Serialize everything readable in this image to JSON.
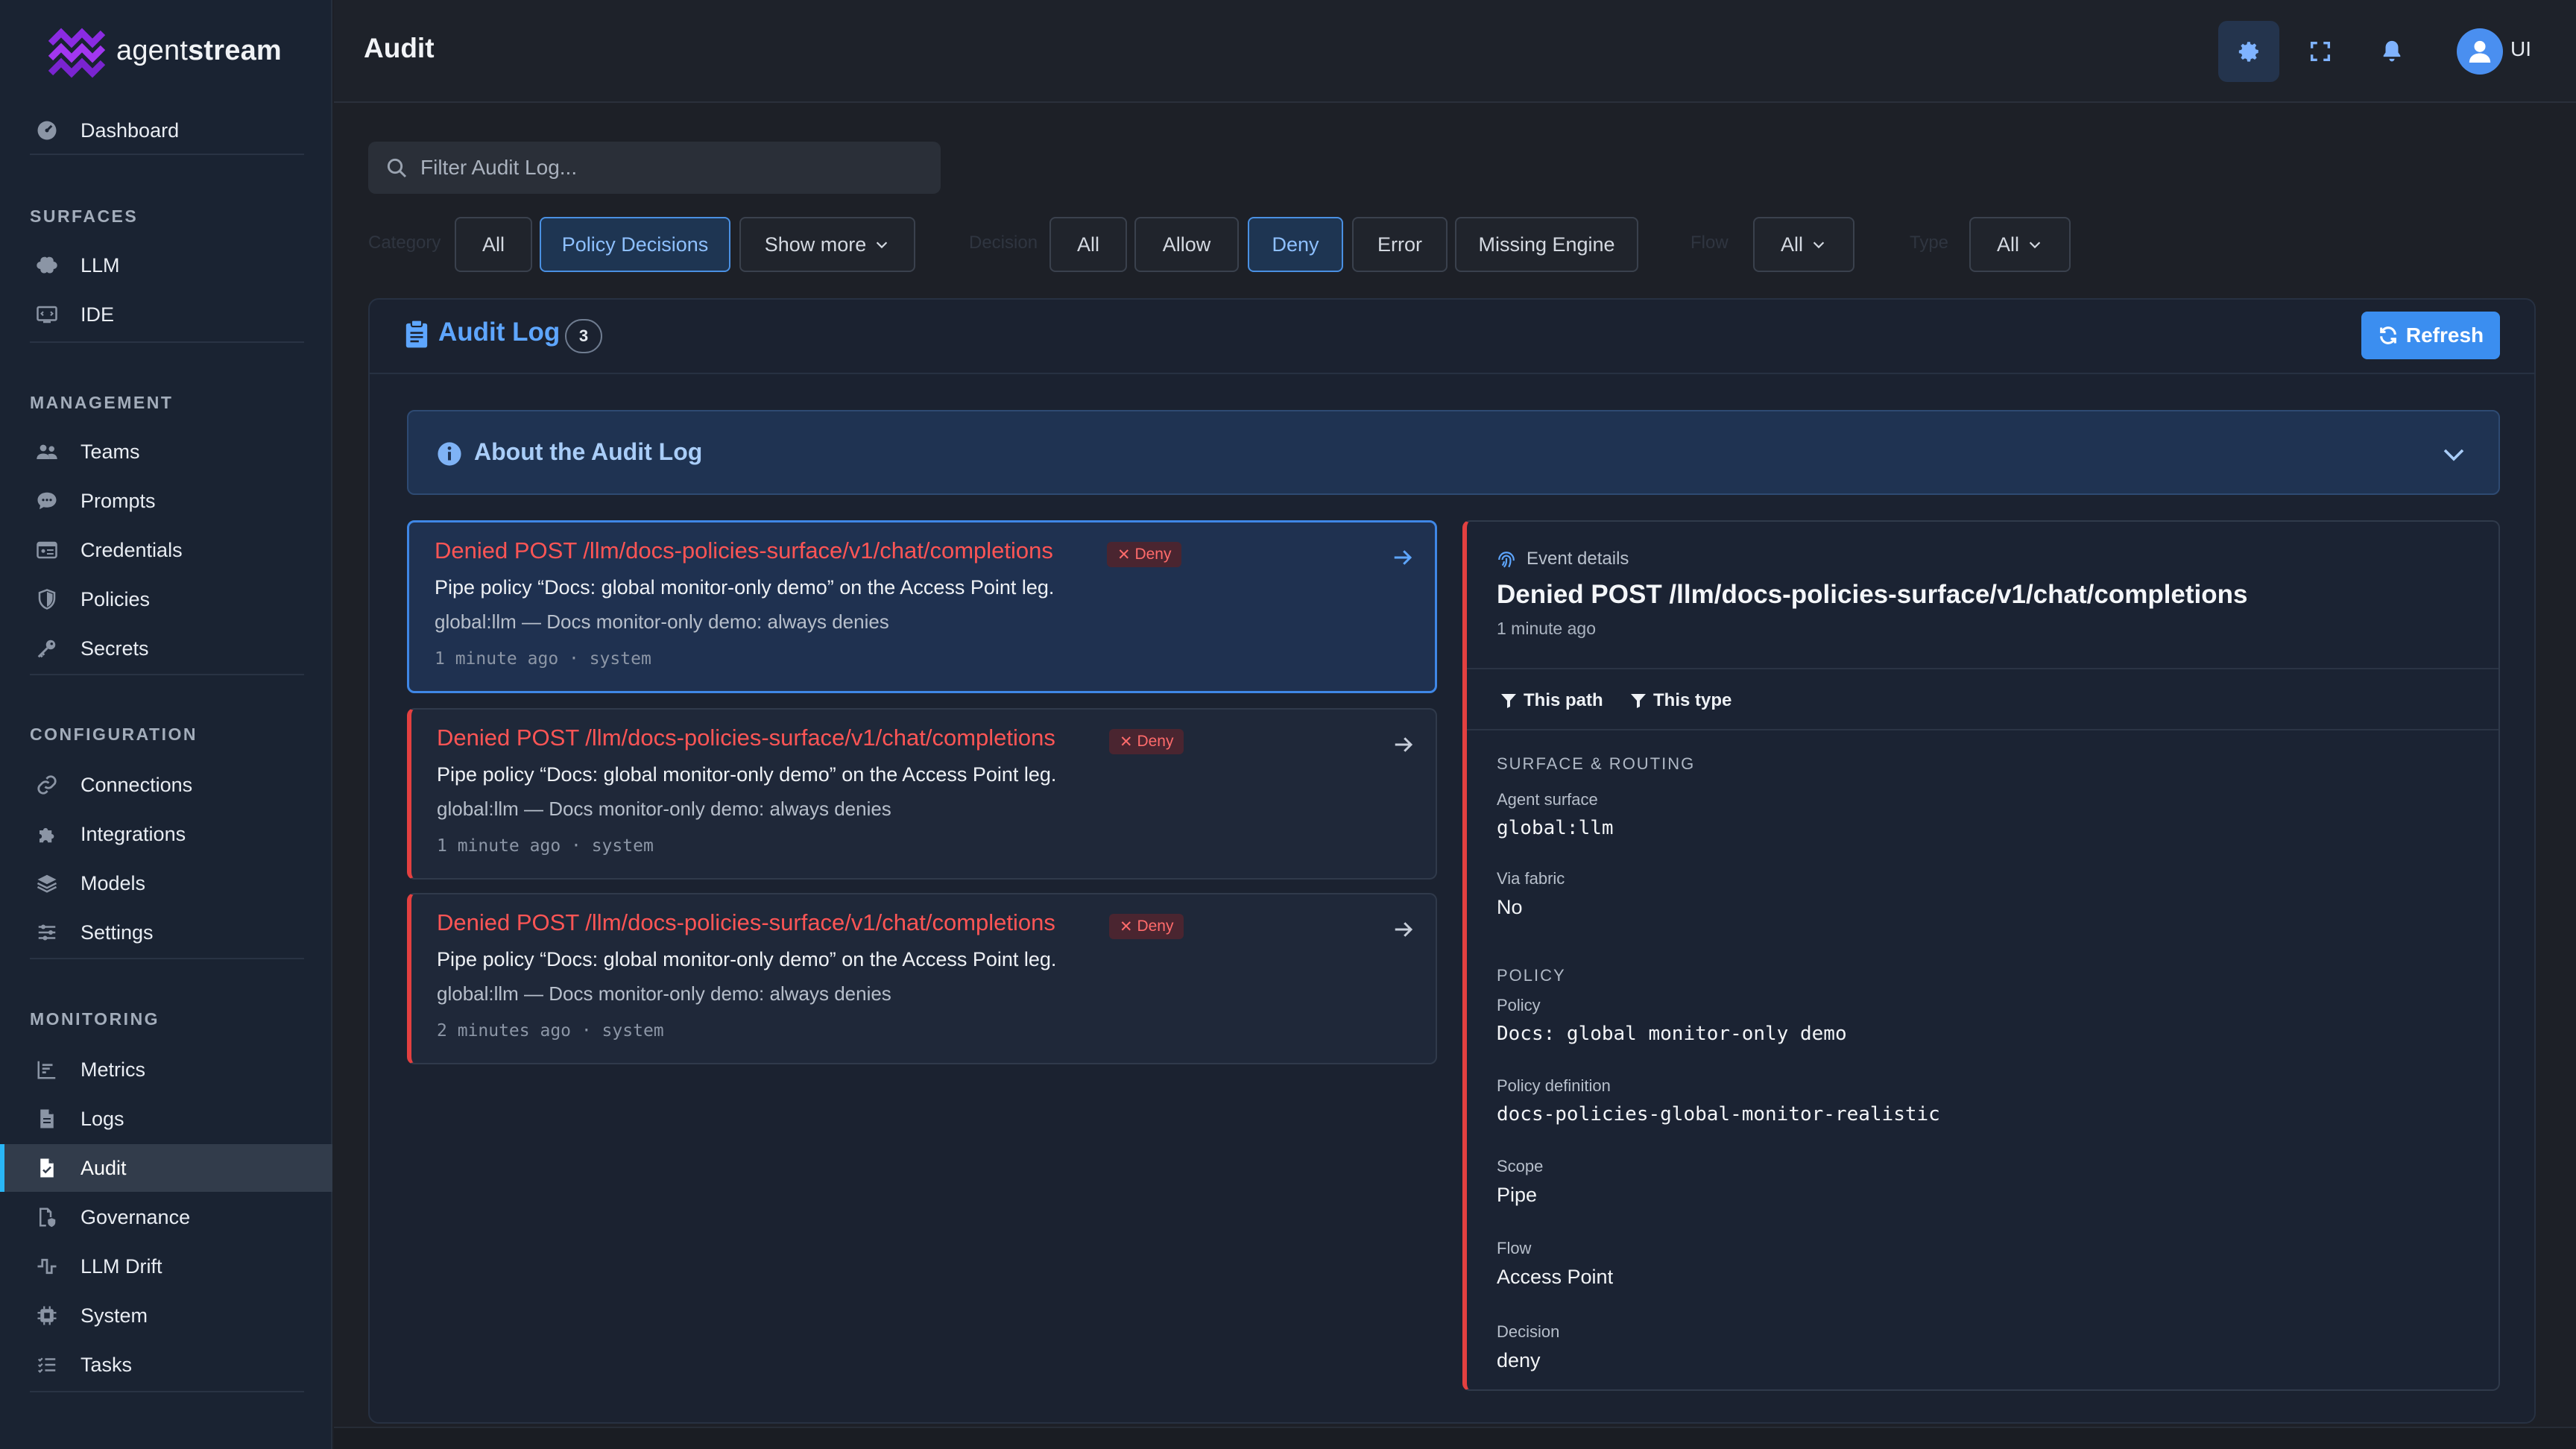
{
  "brand": {
    "name_light": "agent",
    "name_bold": "stream",
    "accent": "#8b2be2"
  },
  "sidebar": {
    "top": [
      {
        "label": "Dashboard",
        "icon": "dashboard-icon"
      }
    ],
    "sections": [
      {
        "title": "SURFACES",
        "items": [
          {
            "label": "LLM",
            "icon": "brain-icon"
          },
          {
            "label": "IDE",
            "icon": "ide-icon"
          }
        ]
      },
      {
        "title": "MANAGEMENT",
        "items": [
          {
            "label": "Teams",
            "icon": "users-icon"
          },
          {
            "label": "Prompts",
            "icon": "chat-icon"
          },
          {
            "label": "Credentials",
            "icon": "id-card-icon"
          },
          {
            "label": "Policies",
            "icon": "shield-icon"
          },
          {
            "label": "Secrets",
            "icon": "key-icon"
          }
        ]
      },
      {
        "title": "CONFIGURATION",
        "items": [
          {
            "label": "Connections",
            "icon": "link-icon"
          },
          {
            "label": "Integrations",
            "icon": "puzzle-icon"
          },
          {
            "label": "Models",
            "icon": "layers-icon"
          },
          {
            "label": "Settings",
            "icon": "sliders-icon"
          }
        ]
      },
      {
        "title": "MONITORING",
        "items": [
          {
            "label": "Metrics",
            "icon": "chart-icon"
          },
          {
            "label": "Logs",
            "icon": "file-icon"
          },
          {
            "label": "Audit",
            "icon": "audit-file-icon",
            "active": true
          },
          {
            "label": "Governance",
            "icon": "governance-icon"
          },
          {
            "label": "LLM Drift",
            "icon": "drift-icon"
          },
          {
            "label": "System",
            "icon": "chip-icon"
          },
          {
            "label": "Tasks",
            "icon": "tasks-icon"
          }
        ]
      }
    ]
  },
  "header": {
    "title": "Audit",
    "user_initials": "UI"
  },
  "search": {
    "placeholder": "Filter Audit Log..."
  },
  "filters": {
    "category": {
      "label": "Category",
      "options": [
        "All",
        "Policy Decisions"
      ],
      "selected": "Policy Decisions",
      "more": "Show more"
    },
    "decision": {
      "label": "Decision",
      "options": [
        "All",
        "Allow",
        "Deny",
        "Error",
        "Missing Engine"
      ],
      "selected": "Deny"
    },
    "flow": {
      "label": "Flow",
      "value": "All"
    },
    "type": {
      "label": "Type",
      "value": "All"
    }
  },
  "panel": {
    "title": "Audit Log",
    "count": "3",
    "refresh_label": "Refresh",
    "about_title": "About the Audit Log"
  },
  "events": [
    {
      "title": "Denied POST /llm/docs-policies-surface/v1/chat/completions",
      "badge": "Deny",
      "description": "Pipe policy “Docs: global monitor-only demo” on the Access Point leg.",
      "sub": "global:llm — Docs monitor-only demo: always denies",
      "meta": "1 minute ago · system",
      "selected": true
    },
    {
      "title": "Denied POST /llm/docs-policies-surface/v1/chat/completions",
      "badge": "Deny",
      "description": "Pipe policy “Docs: global monitor-only demo” on the Access Point leg.",
      "sub": "global:llm — Docs monitor-only demo: always denies",
      "meta": "1 minute ago · system"
    },
    {
      "title": "Denied POST /llm/docs-policies-surface/v1/chat/completions",
      "badge": "Deny",
      "description": "Pipe policy “Docs: global monitor-only demo” on the Access Point leg.",
      "sub": "global:llm — Docs monitor-only demo: always denies",
      "meta": "2 minutes ago · system"
    }
  ],
  "details": {
    "kicker": "Event details",
    "title": "Denied POST /llm/docs-policies-surface/v1/chat/completions",
    "time": "1 minute ago",
    "filter_path": "This path",
    "filter_type": "This type",
    "surface_section": "SURFACE & ROUTING",
    "agent_surface_label": "Agent surface",
    "agent_surface": "global:llm",
    "via_fabric_label": "Via fabric",
    "via_fabric": "No",
    "policy_section": "POLICY",
    "policy_label": "Policy",
    "policy": "Docs: global monitor-only demo",
    "policy_def_label": "Policy definition",
    "policy_def": "docs-policies-global-monitor-realistic",
    "scope_label": "Scope",
    "scope": "Pipe",
    "flow_label": "Flow",
    "flow": "Access Point",
    "decision_label": "Decision",
    "decision": "deny"
  },
  "colors": {
    "accent_blue": "#3b8ef0",
    "deny_red": "#ff5555",
    "active_indicator": "#29b6f6"
  }
}
